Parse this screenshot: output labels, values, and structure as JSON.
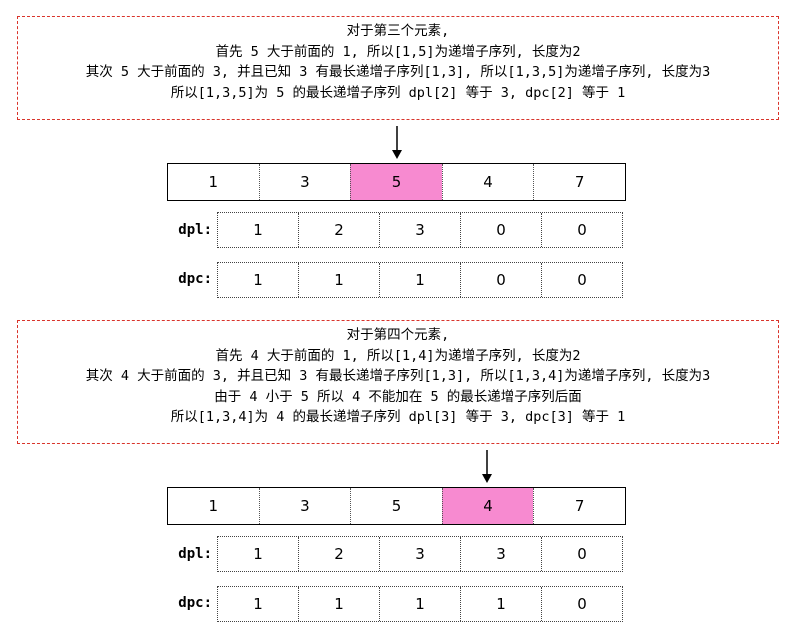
{
  "step3": {
    "note": [
      "对于第三个元素,",
      "首先 5 大于前面的 1, 所以[1,5]为递增子序列, 长度为2",
      "其次 5 大于前面的 3, 并且已知 3 有最长递增子序列[1,3], 所以[1,3,5]为递增子序列, 长度为3",
      "所以[1,3,5]为 5 的最长递增子序列 dpl[2] 等于 3, dpc[2] 等于 1"
    ],
    "array": [
      "1",
      "3",
      "5",
      "4",
      "7"
    ],
    "highlight_index": 2,
    "dpl_label": "dpl:",
    "dpl": [
      "1",
      "2",
      "3",
      "0",
      "0"
    ],
    "dpc_label": "dpc:",
    "dpc": [
      "1",
      "1",
      "1",
      "0",
      "0"
    ]
  },
  "step4": {
    "note": [
      "对于第四个元素,",
      "首先 4 大于前面的 1, 所以[1,4]为递增子序列, 长度为2",
      "其次 4 大于前面的 3, 并且已知 3 有最长递增子序列[1,3], 所以[1,3,4]为递增子序列, 长度为3",
      "由于 4 小于 5 所以 4 不能加在 5 的最长递增子序列后面",
      "所以[1,3,4]为 4 的最长递增子序列 dpl[3] 等于 3, dpc[3] 等于 1"
    ],
    "array": [
      "1",
      "3",
      "5",
      "4",
      "7"
    ],
    "highlight_index": 3,
    "dpl_label": "dpl:",
    "dpl": [
      "1",
      "2",
      "3",
      "3",
      "0"
    ],
    "dpc_label": "dpc:",
    "dpc": [
      "1",
      "1",
      "1",
      "1",
      "0"
    ]
  },
  "colors": {
    "note_border": "#d9342b",
    "highlight": "#f78ad0"
  }
}
